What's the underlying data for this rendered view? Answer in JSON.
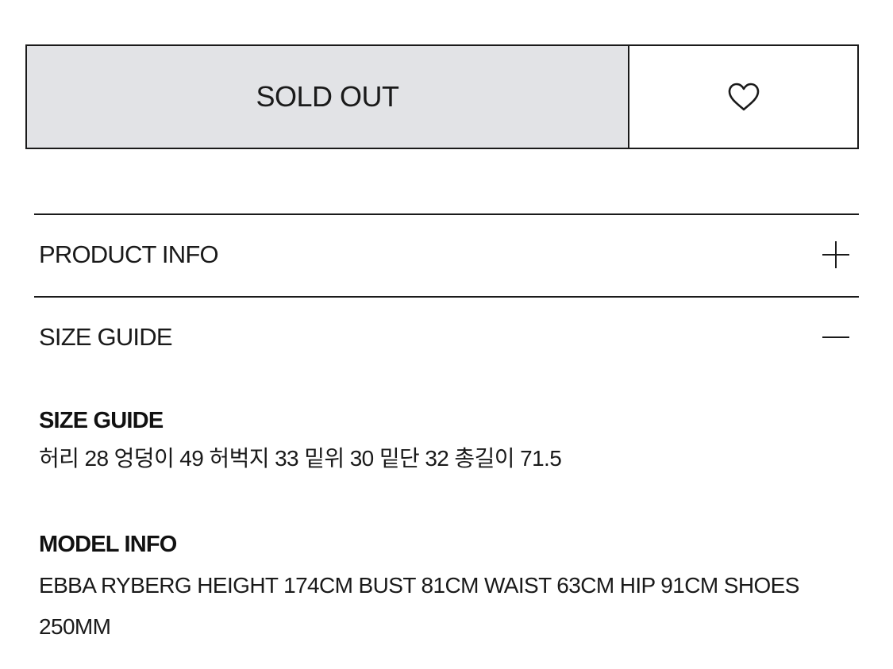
{
  "purchase": {
    "sold_out_label": "SOLD OUT",
    "wishlist_icon": "heart-icon"
  },
  "accordion": [
    {
      "label": "PRODUCT INFO",
      "state": "collapsed",
      "icon": "plus-icon"
    },
    {
      "label": "SIZE GUIDE",
      "state": "expanded",
      "icon": "minus-icon"
    }
  ],
  "size_guide": {
    "heading": "SIZE GUIDE",
    "text": "허리 28 엉덩이 49 허벅지 33 밑위 30 밑단 32 총길이 71.5"
  },
  "model_info": {
    "heading": "MODEL INFO",
    "text": "EBBA RYBERG HEIGHT 174CM BUST 81CM WAIST 63CM HIP 91CM SHOES 250MM"
  },
  "colors": {
    "sold_out_bg": "#e2e3e6",
    "border": "#1a1a1a",
    "text": "#111111"
  }
}
